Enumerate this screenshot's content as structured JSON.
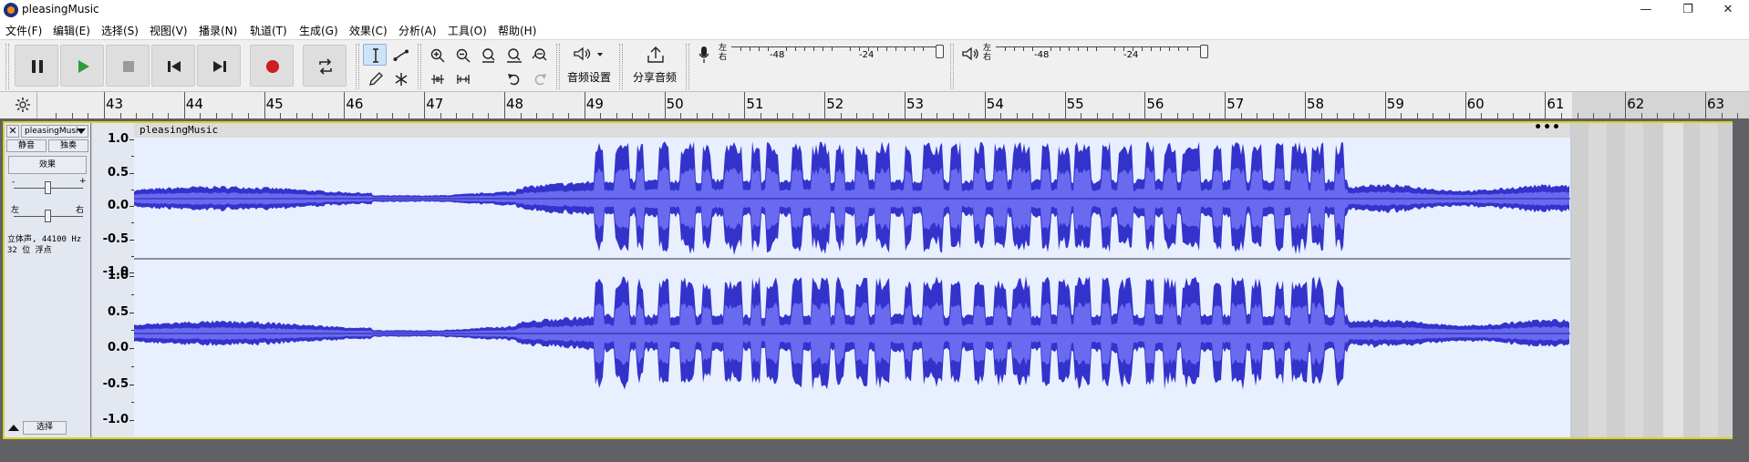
{
  "window": {
    "title": "pleasingMusic",
    "minimize_glyph": "—",
    "maximize_glyph": "❐",
    "close_glyph": "✕"
  },
  "menu": [
    {
      "label": "文件(F)"
    },
    {
      "label": "编辑(E)"
    },
    {
      "label": "选择(S)"
    },
    {
      "label": "视图(V)"
    },
    {
      "label": "播录(N)"
    },
    {
      "label": "轨道(T)"
    },
    {
      "label": "生成(G)"
    },
    {
      "label": "效果(C)"
    },
    {
      "label": "分析(A)"
    },
    {
      "label": "工具(O)"
    },
    {
      "label": "帮助(H)"
    }
  ],
  "toolbar": {
    "audio_setup_label": "音频设置",
    "share_audio_label": "分享音频",
    "record_meter": {
      "lr": [
        "左",
        "右"
      ],
      "ticks": [
        "-48",
        "-24"
      ]
    },
    "playback_meter": {
      "lr": [
        "左",
        "右"
      ],
      "ticks": [
        "-48",
        "-24"
      ]
    },
    "colors": {
      "play": "#2e9b3c",
      "record": "#cc1f1f",
      "stop_disabled": "#9a9a9a"
    }
  },
  "ruler": {
    "labels": [
      "43",
      "44",
      "45",
      "46",
      "47",
      "48",
      "49",
      "50",
      "51",
      "52",
      "53",
      "54",
      "55",
      "56",
      "57",
      "58",
      "59",
      "60",
      "61",
      "62",
      "63"
    ]
  },
  "track": {
    "name": "pleasingMusi",
    "mute_label": "静音",
    "solo_label": "独奏",
    "effects_label": "效果",
    "gain_minus": "-",
    "gain_plus": "+",
    "pan_left": "左",
    "pan_right": "右",
    "info_line1": "立体声, 44100 Hz",
    "info_line2": "32 位 浮点",
    "select_label": "选择",
    "clip_name": "pleasingMusic",
    "clip_menu": "•••",
    "vscale": [
      "1.0",
      "0.5",
      "0.0",
      "-0.5",
      "-1.0"
    ],
    "colors": {
      "wave": "#3333cc",
      "wave_rms": "#6a6af0",
      "clip_bg": "#e8efff",
      "selection_border": "#d8cf2a"
    }
  }
}
